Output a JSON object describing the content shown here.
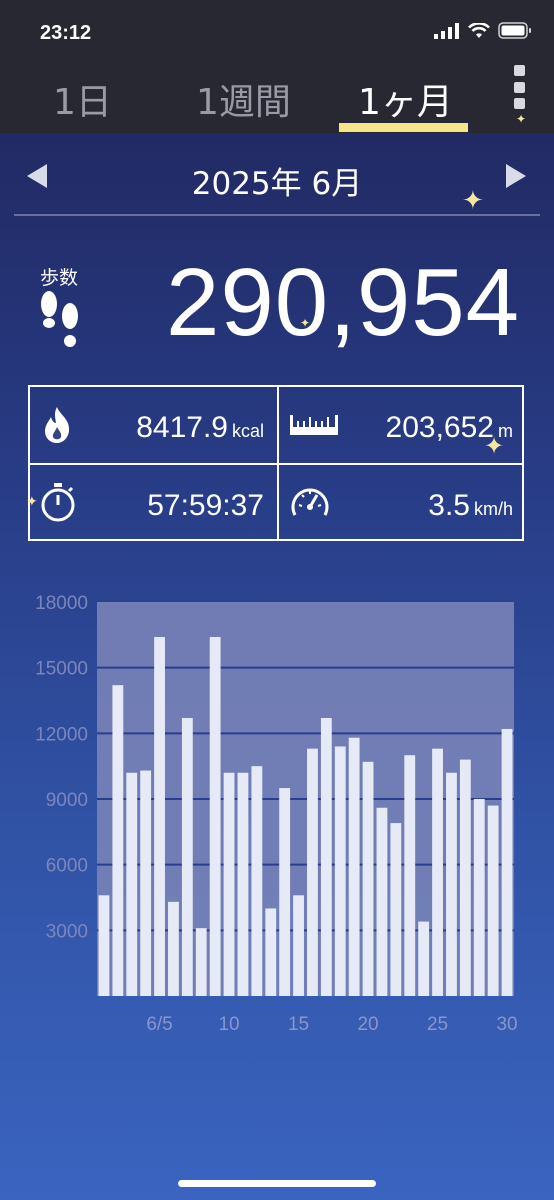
{
  "status_bar": {
    "time": "23:12"
  },
  "tabs": [
    {
      "label": "1日",
      "active": false
    },
    {
      "label": "1週間",
      "active": false
    },
    {
      "label": "1ヶ月",
      "active": true
    }
  ],
  "month_nav": {
    "label": "2025年 6月"
  },
  "steps": {
    "label": "歩数",
    "value": "290,954"
  },
  "stats": {
    "calories": {
      "value": "8417.9",
      "unit": "kcal"
    },
    "distance": {
      "value": "203,652",
      "unit": "m"
    },
    "duration": {
      "value": "57:59:37"
    },
    "speed": {
      "value": "3.5",
      "unit": "km/h"
    }
  },
  "colors": {
    "tab_underline": "#f3e58a",
    "tab_bar": "#272832",
    "bar_fill": "#e6e9f6",
    "chart_panel": "#7d86b8"
  },
  "chart_data": {
    "type": "bar",
    "days": [
      1,
      2,
      3,
      4,
      5,
      6,
      7,
      8,
      9,
      10,
      11,
      12,
      13,
      14,
      15,
      16,
      17,
      18,
      19,
      20,
      21,
      22,
      23,
      24,
      25,
      26,
      27,
      28,
      29,
      30
    ],
    "values": [
      4600,
      14200,
      10200,
      10300,
      16400,
      4300,
      12700,
      3100,
      16400,
      10200,
      10200,
      10500,
      4000,
      9500,
      4600,
      11300,
      12700,
      11400,
      11800,
      10700,
      8600,
      7900,
      11000,
      3400,
      11300,
      10200,
      10800,
      9000,
      8700,
      12200
    ],
    "x_tick_labels": [
      "6/5",
      "10",
      "15",
      "20",
      "25",
      "30"
    ],
    "y_tick_labels": [
      "3000",
      "6000",
      "9000",
      "12000",
      "15000",
      "18000"
    ],
    "ylim": [
      0,
      18000
    ]
  }
}
